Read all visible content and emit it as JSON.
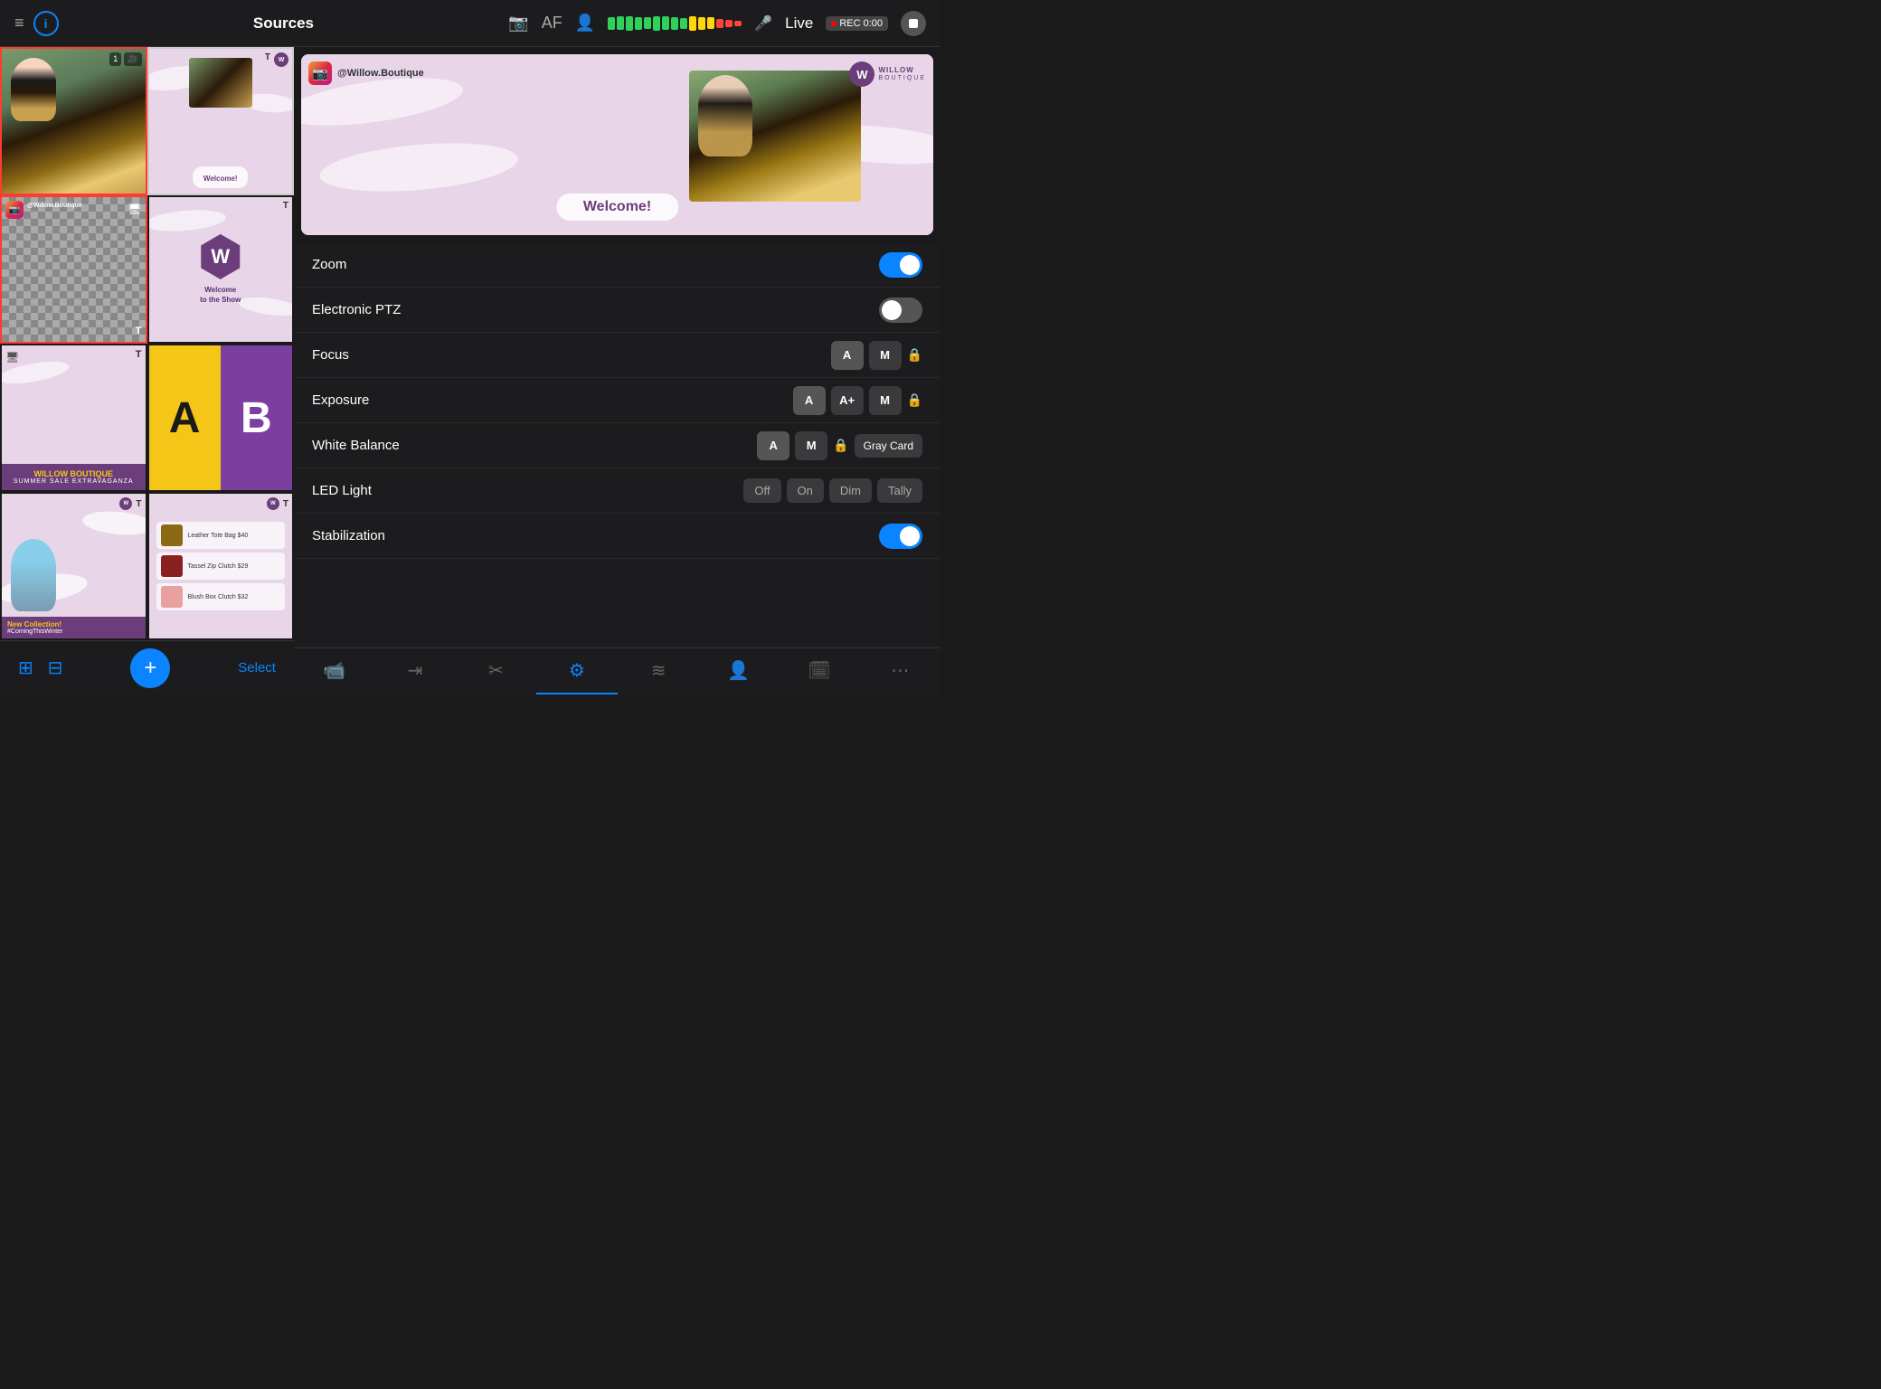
{
  "header": {
    "title": "Sources",
    "live_label": "Live",
    "rec_label": "REC",
    "rec_time": "0:00",
    "af_label": "AF"
  },
  "sources": {
    "grid": [
      {
        "id": "camera",
        "type": "camera",
        "active": true
      },
      {
        "id": "welcome_show",
        "type": "welcome",
        "active": false
      },
      {
        "id": "transparent1",
        "type": "transparent",
        "active": true
      },
      {
        "id": "logo_scene",
        "type": "logo",
        "active": false
      },
      {
        "id": "boutique_sale",
        "type": "boutique_sale",
        "active": false
      },
      {
        "id": "ab_test",
        "type": "ab",
        "active": false
      },
      {
        "id": "new_collection",
        "type": "new_collection",
        "active": false
      },
      {
        "id": "product_list",
        "type": "products",
        "active": false
      }
    ],
    "products": [
      {
        "name": "Leather Tote Bag $40",
        "color": "#8B6914"
      },
      {
        "name": "Tassel Zip Clutch $29",
        "color": "#8B2020"
      },
      {
        "name": "Blush Box Clutch $32",
        "color": "#e8a0a0"
      }
    ]
  },
  "preview": {
    "ig_handle": "@Willow.Boutique",
    "welcome_text": "Welcome!",
    "brand_name": "WILLOW",
    "brand_sub": "BOUTIQUE"
  },
  "controls": {
    "zoom": {
      "label": "Zoom",
      "enabled": true
    },
    "electronic_ptz": {
      "label": "Electronic PTZ",
      "enabled": false
    },
    "focus": {
      "label": "Focus",
      "modes": [
        "A",
        "M"
      ],
      "has_lock": true
    },
    "exposure": {
      "label": "Exposure",
      "modes": [
        "A",
        "A+",
        "M"
      ],
      "has_lock": true
    },
    "white_balance": {
      "label": "White Balance",
      "modes": [
        "A",
        "M"
      ],
      "has_lock": true,
      "gray_card": "Gray Card"
    },
    "led_light": {
      "label": "LED Light",
      "modes": [
        "Off",
        "On",
        "Dim",
        "Tally"
      ]
    },
    "stabilization": {
      "label": "Stabilization",
      "enabled": true
    }
  },
  "toolbar": {
    "add_label": "+",
    "select_label": "Select"
  },
  "tabs": [
    {
      "id": "camera",
      "icon": "📹",
      "active": false
    },
    {
      "id": "transition",
      "icon": "⇥",
      "active": false
    },
    {
      "id": "crop",
      "icon": "✂",
      "active": false
    },
    {
      "id": "settings",
      "icon": "⚙",
      "active": true
    },
    {
      "id": "audio",
      "icon": "≋",
      "active": false
    },
    {
      "id": "overlay",
      "icon": "👤",
      "active": false
    },
    {
      "id": "timer",
      "icon": "🗓",
      "active": false
    },
    {
      "id": "more",
      "icon": "⋯",
      "active": false
    }
  ],
  "meter_bars": [
    {
      "color": "green"
    },
    {
      "color": "green"
    },
    {
      "color": "green"
    },
    {
      "color": "green"
    },
    {
      "color": "green"
    },
    {
      "color": "green"
    },
    {
      "color": "green"
    },
    {
      "color": "green"
    },
    {
      "color": "green"
    },
    {
      "color": "yellow"
    },
    {
      "color": "yellow"
    },
    {
      "color": "yellow"
    },
    {
      "color": "red"
    },
    {
      "color": "red"
    },
    {
      "color": "red"
    }
  ]
}
